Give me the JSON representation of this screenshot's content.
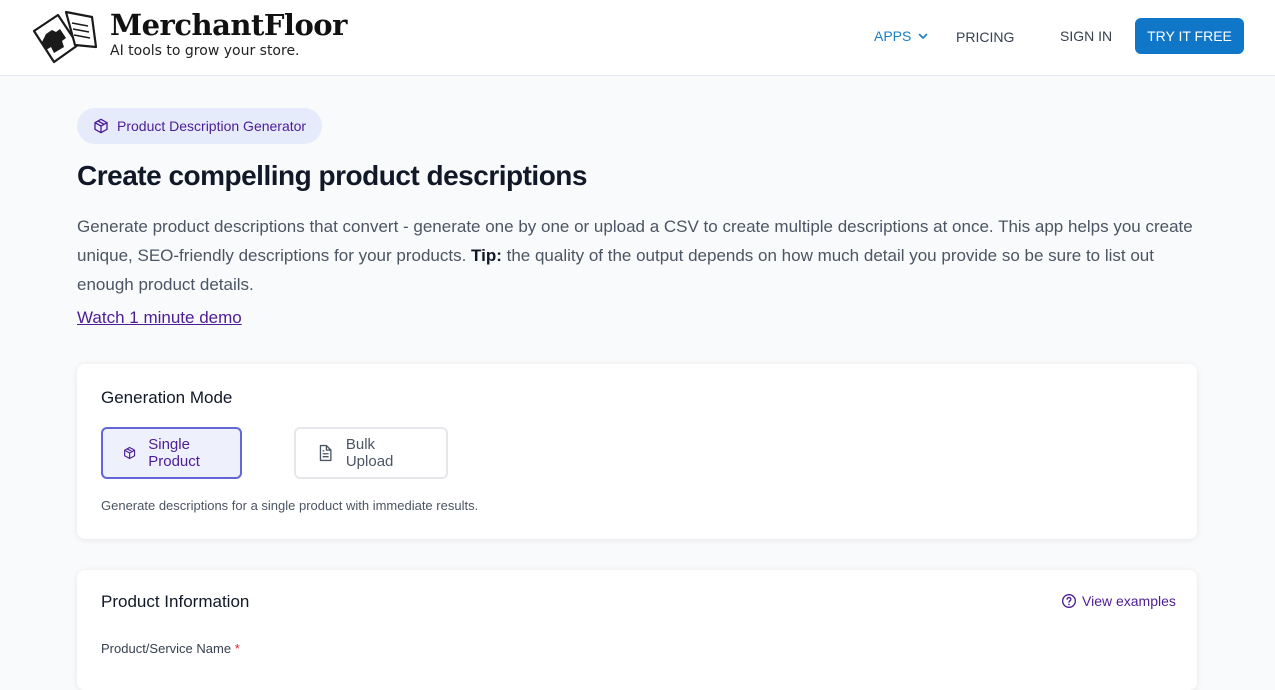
{
  "header": {
    "brand_name": "MerchantFloor",
    "tagline": "AI tools to grow your store.",
    "nav": {
      "apps": "APPS",
      "pricing": "PRICING",
      "sign_in": "SIGN IN",
      "try_free": "TRY IT FREE"
    }
  },
  "hero": {
    "pill_label": "Product Description Generator",
    "title": "Create compelling product descriptions",
    "intro_text": "Generate product descriptions that convert - generate one by one or upload a CSV to create multiple descriptions at once. This app helps you create unique, SEO-friendly descriptions for your products. ",
    "tip_label": "Tip:",
    "tip_text": " the quality of the output depends on how much detail you provide so be sure to list out enough product details.",
    "demo_link": "Watch 1 minute demo"
  },
  "generation_mode": {
    "title": "Generation Mode",
    "options": [
      {
        "label": "Single Product",
        "icon": "cube-icon",
        "selected": true
      },
      {
        "label": "Bulk Upload",
        "icon": "document-icon",
        "selected": false
      }
    ],
    "hint": "Generate descriptions for a single product with immediate results."
  },
  "product_information": {
    "title": "Product Information",
    "view_examples": "View examples",
    "name_label": "Product/Service Name",
    "required_mark": "*"
  },
  "colors": {
    "accent": "#0f76c8",
    "purple": "#4c1d95",
    "selected_border": "#6366d9"
  }
}
